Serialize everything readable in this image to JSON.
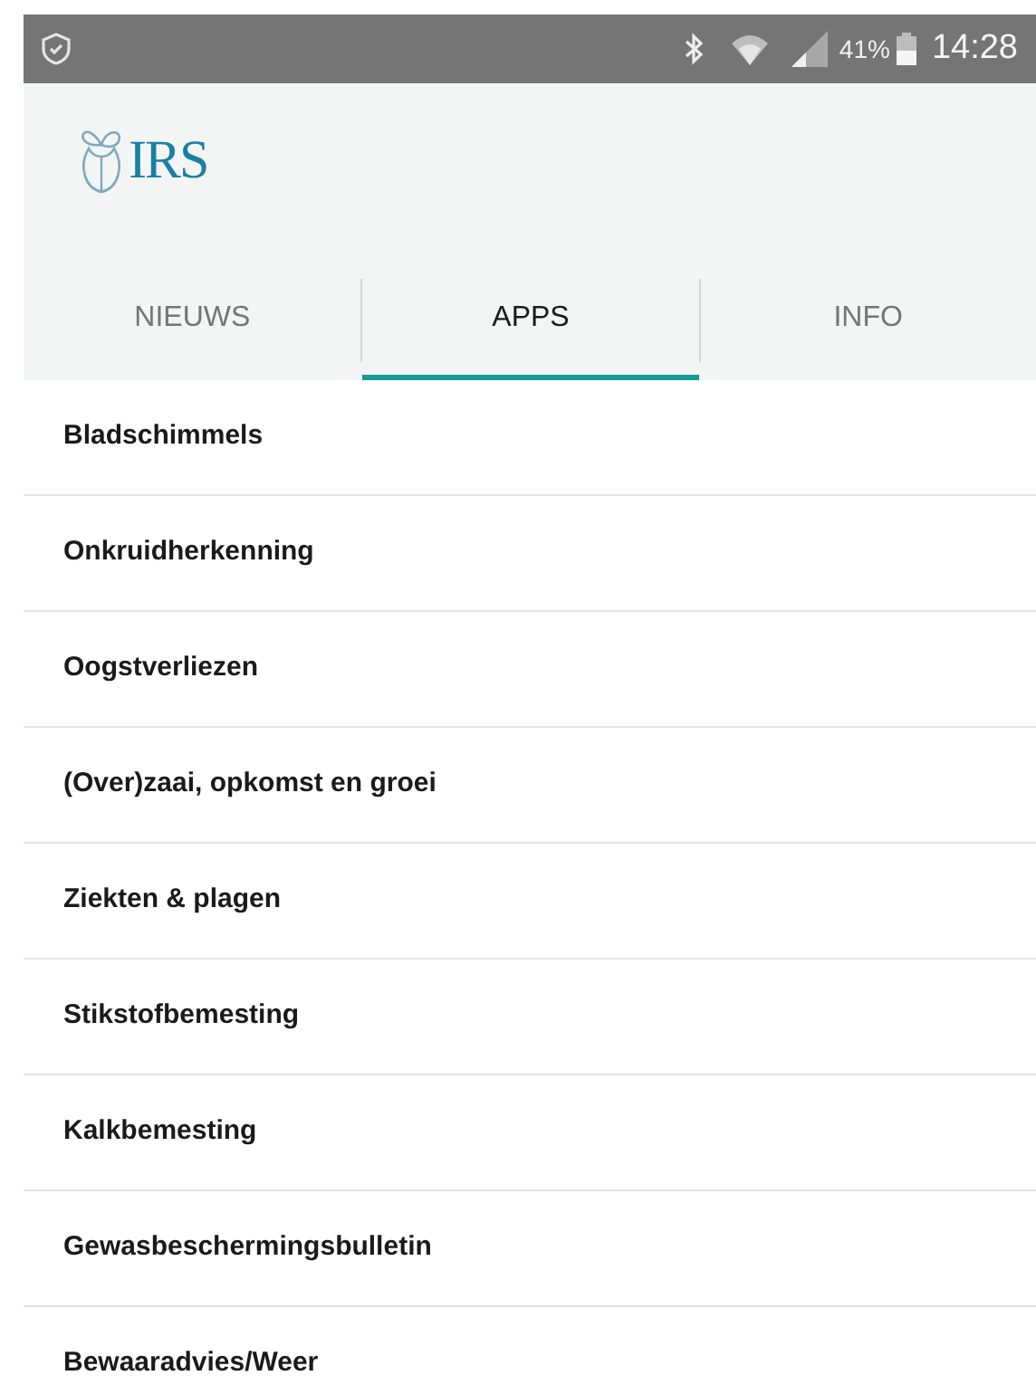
{
  "status_bar": {
    "battery": "41%",
    "time": "14:28"
  },
  "header": {
    "logo_text": "IRS"
  },
  "tabs": [
    {
      "label": "NIEUWS",
      "selected": false
    },
    {
      "label": "APPS",
      "selected": true
    },
    {
      "label": "INFO",
      "selected": false
    }
  ],
  "items": [
    "Bladschimmels",
    "Onkruidherkenning",
    "Oogstverliezen",
    "(Over)zaai, opkomst en groei",
    "Ziekten & plagen",
    "Stikstofbemesting",
    "Kalkbemesting",
    "Gewasbeschermingsbulletin",
    "Bewaaradvies/Weer"
  ]
}
